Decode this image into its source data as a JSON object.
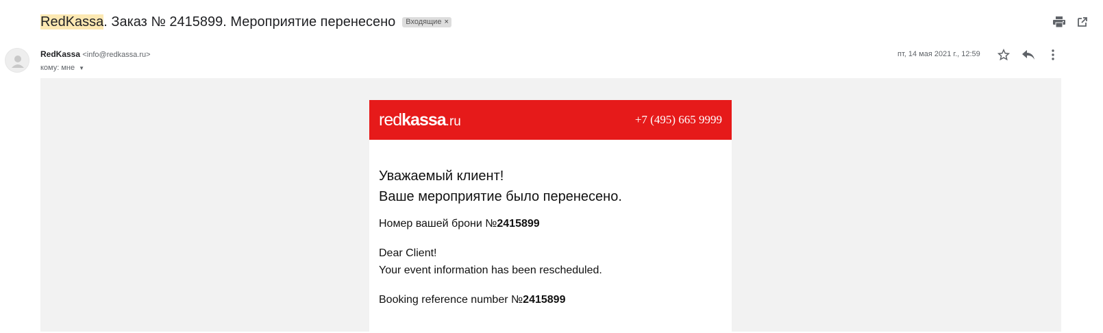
{
  "subject": {
    "highlight": "RedKassa",
    "rest": ". Заказ № 2415899. Мероприятие перенесено",
    "label_chip": "Входящие",
    "chip_close": "×"
  },
  "sender": {
    "name": "RedKassa",
    "email": "<info@redkassa.ru>",
    "to": "кому: мне",
    "date": "пт, 14 мая 2021 г., 12:59"
  },
  "icons": {
    "print": "print-icon",
    "open_new_window": "open-in-new-window-icon",
    "star": "star-icon",
    "reply": "reply-icon",
    "more": "more-vert-icon",
    "avatar": "default-avatar-icon"
  },
  "email": {
    "logo_red": "red",
    "logo_kassa": "kassa",
    "logo_ru": ".ru",
    "phone": "+7 (495) 665 9999",
    "greeting_ru": "Уважаемый клиент!",
    "message_ru": "Ваше мероприятие было перенесено.",
    "booking_ru_label": "Номер вашей брони №",
    "booking_number": "2415899",
    "greeting_en": "Dear Client!",
    "message_en": "Your event information has been rescheduled.",
    "booking_en_label": "Booking reference number №"
  },
  "colors": {
    "header_red": "#e61a1a",
    "subject_highlight": "#fce8b2",
    "body_background": "#f2f2f2"
  }
}
